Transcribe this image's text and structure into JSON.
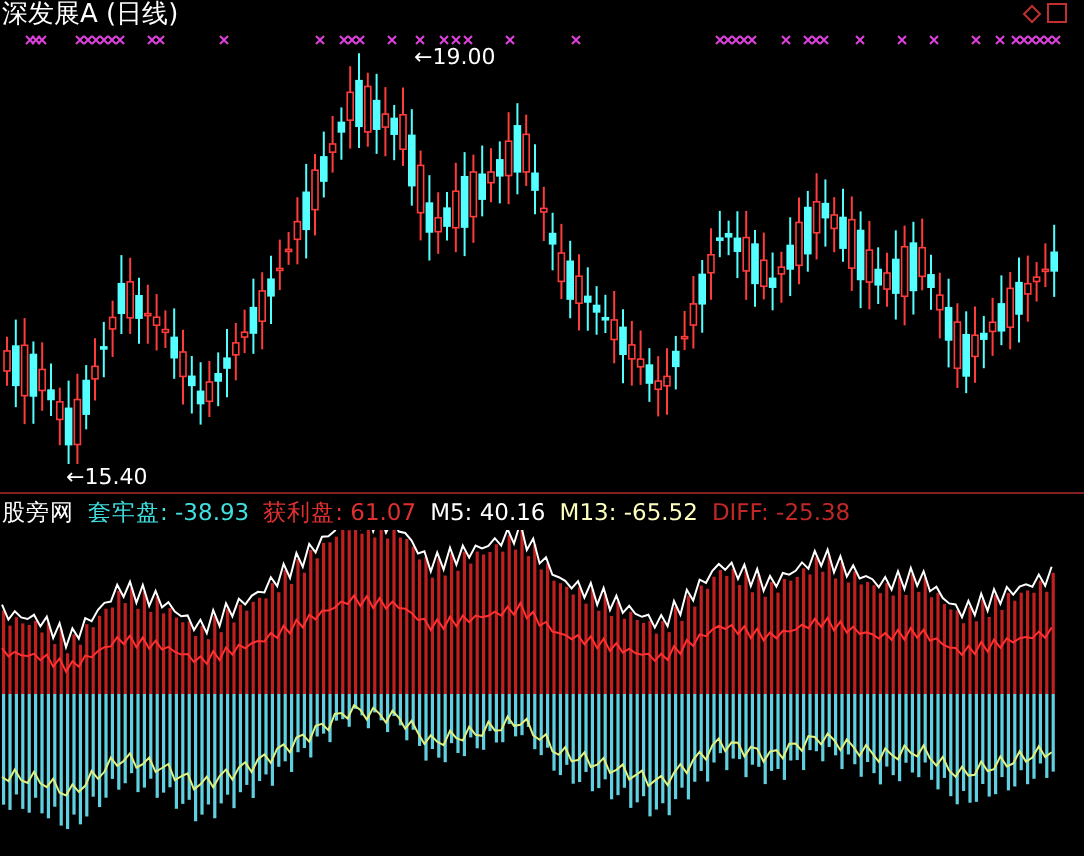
{
  "window": {
    "title": "深发展A (日线)"
  },
  "price_panel": {
    "high_label": "←19.00",
    "low_label": "←15.40"
  },
  "indicator_panel": {
    "name": "股旁网",
    "legend": [
      {
        "text": "套牢盘: -38.93",
        "color": "#40e0e0"
      },
      {
        "text": "获利盘: 61.07",
        "color": "#e03030"
      },
      {
        "text": "M5: 40.16",
        "color": "#ffffff"
      },
      {
        "text": "M13: -65.52",
        "color": "#ffffc0"
      },
      {
        "text": "DIFF: -25.38",
        "color": "#c02828"
      }
    ]
  }
}
